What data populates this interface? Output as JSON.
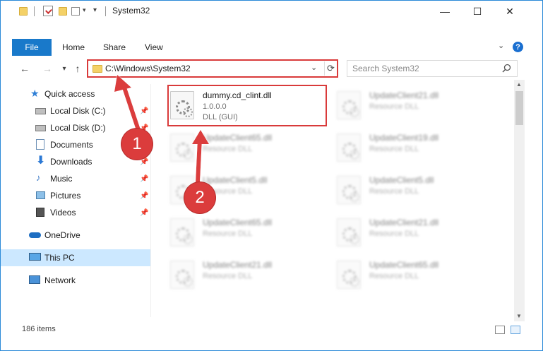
{
  "window": {
    "title": "System32",
    "minimize": "—",
    "maximize": "☐",
    "close": "✕"
  },
  "ribbon": {
    "tabs": [
      "File",
      "Home",
      "Share",
      "View"
    ]
  },
  "nav": {
    "back": "←",
    "forward": "→",
    "recent": "▾",
    "up": "↑",
    "address": "C:\\Windows\\System32",
    "search_placeholder": "Search System32"
  },
  "sidebar": {
    "items": [
      {
        "label": "Quick access",
        "icon": "star-icon",
        "pinned": false
      },
      {
        "label": "Local Disk (C:)",
        "icon": "drive-icon",
        "pinned": true
      },
      {
        "label": "Local Disk (D:)",
        "icon": "drive-icon",
        "pinned": true
      },
      {
        "label": "Documents",
        "icon": "documents-icon",
        "pinned": true
      },
      {
        "label": "Downloads",
        "icon": "downloads-icon",
        "pinned": true
      },
      {
        "label": "Music",
        "icon": "music-icon",
        "pinned": true
      },
      {
        "label": "Pictures",
        "icon": "pictures-icon",
        "pinned": true
      },
      {
        "label": "Videos",
        "icon": "videos-icon",
        "pinned": true
      },
      {
        "label": "OneDrive",
        "icon": "cloud-icon",
        "pinned": false
      },
      {
        "label": "This PC",
        "icon": "computer-icon",
        "pinned": false,
        "selected": true
      },
      {
        "label": "Network",
        "icon": "network-icon",
        "pinned": false
      }
    ]
  },
  "files": {
    "highlighted": {
      "name": "dummy.cd_clint.dll",
      "version": "1.0.0.0",
      "type": "DLL (GUI)"
    },
    "left_column": [
      {
        "name": "UpdateClient65.dll",
        "type": "Resource DLL"
      },
      {
        "name": "UpdateClient5.dll",
        "type": "Resource DLL"
      },
      {
        "name": "UpdateClient65.dll",
        "type": "Resource DLL"
      },
      {
        "name": "UpdateClient21.dll",
        "type": "Resource DLL"
      }
    ],
    "right_column": [
      {
        "name": "UpdateClient21.dll",
        "type": "Resource DLL"
      },
      {
        "name": "UpdateClient19.dll",
        "type": "Resource DLL"
      },
      {
        "name": "UpdateClient5.dll",
        "type": "Resource DLL"
      },
      {
        "name": "UpdateClient21.dll",
        "type": "Resource DLL"
      },
      {
        "name": "UpdateClient65.dll",
        "type": "Resource DLL"
      }
    ]
  },
  "status": {
    "item_count": "186 items"
  },
  "annotations": {
    "step1": "1",
    "step2": "2",
    "color": "#db3c3c"
  }
}
